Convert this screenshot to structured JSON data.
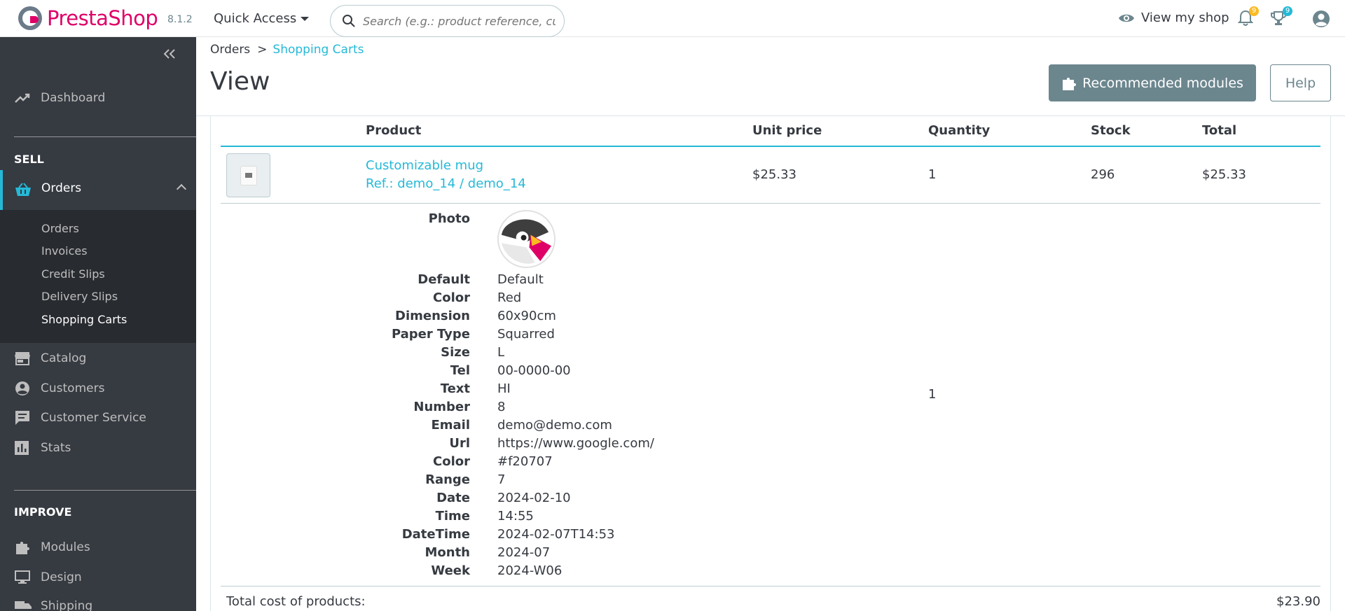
{
  "header": {
    "logo_text": "PrestaShop",
    "version": "8.1.2",
    "quick_access": "Quick Access",
    "search_placeholder": "Search (e.g.: product reference, custon",
    "view_shop": "View my shop",
    "notifications_count": "9",
    "achievements_count": "9",
    "colors": {
      "brand": "#df0067",
      "accent": "#25b9d7",
      "badge_orange": "#fbbb22"
    }
  },
  "sidebar": {
    "dashboard": "Dashboard",
    "sell_title": "SELL",
    "orders": "Orders",
    "orders_sub": [
      "Orders",
      "Invoices",
      "Credit Slips",
      "Delivery Slips",
      "Shopping Carts"
    ],
    "catalog": "Catalog",
    "customers": "Customers",
    "customer_service": "Customer Service",
    "stats": "Stats",
    "improve_title": "IMPROVE",
    "modules": "Modules",
    "design": "Design",
    "shipping": "Shipping"
  },
  "breadcrumb": {
    "parent": "Orders",
    "separator": ">",
    "current": "Shopping Carts"
  },
  "page_title": "View",
  "toolbar": {
    "recommended": "Recommended modules",
    "help": "Help"
  },
  "table": {
    "headers": {
      "product": "Product",
      "unit_price": "Unit price",
      "quantity": "Quantity",
      "stock": "Stock",
      "total": "Total"
    },
    "row": {
      "name": "Customizable mug",
      "ref": "Ref.: demo_14 / demo_14",
      "unit_price": "$25.33",
      "quantity": "1",
      "stock": "296",
      "total": "$25.33"
    },
    "customization_quantity": "1",
    "photo_label": "Photo",
    "attributes": [
      {
        "label": "Default",
        "value": "Default"
      },
      {
        "label": "Color",
        "value": "Red"
      },
      {
        "label": "Dimension",
        "value": "60x90cm"
      },
      {
        "label": "Paper Type",
        "value": "Squarred"
      },
      {
        "label": "Size",
        "value": "L"
      },
      {
        "label": "Tel",
        "value": "00-0000-00"
      },
      {
        "label": "Text",
        "value": "HI"
      },
      {
        "label": "Number",
        "value": "8"
      },
      {
        "label": "Email",
        "value": "demo@demo.com"
      },
      {
        "label": "Url",
        "value": "https://www.google.com/"
      },
      {
        "label": "Color",
        "value": "#f20707"
      },
      {
        "label": "Range",
        "value": "7"
      },
      {
        "label": "Date",
        "value": "2024-02-10"
      },
      {
        "label": "Time",
        "value": "14:55"
      },
      {
        "label": "DateTime",
        "value": "2024-02-07T14:53"
      },
      {
        "label": "Month",
        "value": "2024-07"
      },
      {
        "label": "Week",
        "value": "2024-W06"
      }
    ],
    "total_label": "Total cost of products:",
    "total_value": "$23.90"
  }
}
